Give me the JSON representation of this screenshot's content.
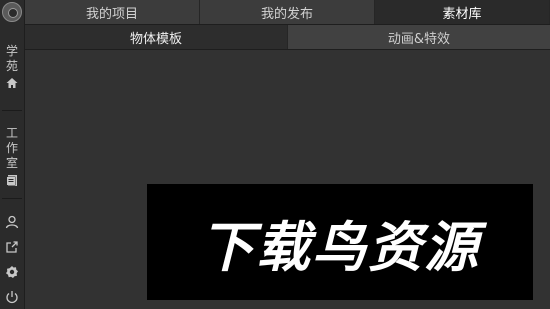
{
  "top_tabs": [
    {
      "label": "我的项目",
      "active": false
    },
    {
      "label": "我的发布",
      "active": false
    },
    {
      "label": "素材库",
      "active": true
    }
  ],
  "sub_tabs": [
    {
      "label": "物体模板",
      "active": true
    },
    {
      "label": "动画&特效",
      "active": false
    }
  ],
  "sidebar": {
    "academy_label": "学苑",
    "studio_label": "工作室",
    "icons": [
      "home-icon",
      "document-icon",
      "user-icon",
      "share-icon",
      "gear-icon",
      "power-icon"
    ]
  },
  "watermark": {
    "text": "下载鸟资源"
  },
  "colors": {
    "background": "#323232",
    "sidebar": "#2b2b2b",
    "tab_bar": "#3c3c3c",
    "tab_active": "#2a2a2a",
    "watermark_bg": "#000000"
  }
}
